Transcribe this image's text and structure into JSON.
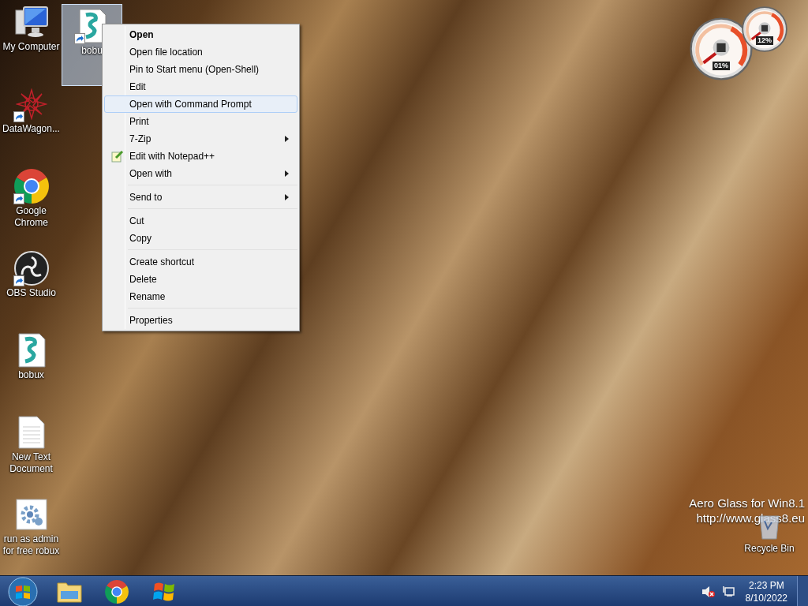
{
  "desktop_icons": [
    {
      "label": "My Computer",
      "kind": "computer",
      "shortcut": false
    },
    {
      "label": "DataWagon...",
      "kind": "mandala",
      "shortcut": true
    },
    {
      "label": "Google Chrome",
      "kind": "chrome",
      "shortcut": true
    },
    {
      "label": "OBS Studio",
      "kind": "obs",
      "shortcut": true
    },
    {
      "label": "bobux",
      "kind": "script",
      "shortcut": false
    },
    {
      "label": "New Text Document",
      "kind": "text",
      "shortcut": false
    },
    {
      "label": "run as admin for free robux",
      "kind": "gear",
      "shortcut": false
    }
  ],
  "selected_icon": {
    "label": "bobu",
    "kind": "script",
    "shortcut": true,
    "selected": true
  },
  "context_menu": [
    {
      "kind": "item",
      "label": "Open",
      "bold": true,
      "selected": false,
      "submenu": false
    },
    {
      "kind": "item",
      "label": "Open file location",
      "bold": false,
      "selected": false,
      "submenu": false
    },
    {
      "kind": "item",
      "label": "Pin to Start menu (Open-Shell)",
      "bold": false,
      "selected": false,
      "submenu": false
    },
    {
      "kind": "item",
      "label": "Edit",
      "bold": false,
      "selected": false,
      "submenu": false
    },
    {
      "kind": "item",
      "label": "Open with Command Prompt",
      "bold": false,
      "selected": true,
      "submenu": false
    },
    {
      "kind": "item",
      "label": "Print",
      "bold": false,
      "selected": false,
      "submenu": false
    },
    {
      "kind": "item",
      "label": "7-Zip",
      "bold": false,
      "selected": false,
      "submenu": true
    },
    {
      "kind": "notepad",
      "label": "Edit with Notepad++",
      "bold": false,
      "selected": false,
      "submenu": false
    },
    {
      "kind": "item",
      "label": "Open with",
      "bold": false,
      "selected": false,
      "submenu": true
    },
    {
      "kind": "separator"
    },
    {
      "kind": "item",
      "label": "Send to",
      "bold": false,
      "selected": false,
      "submenu": true
    },
    {
      "kind": "separator"
    },
    {
      "kind": "item",
      "label": "Cut",
      "bold": false,
      "selected": false,
      "submenu": false
    },
    {
      "kind": "item",
      "label": "Copy",
      "bold": false,
      "selected": false,
      "submenu": false
    },
    {
      "kind": "separator"
    },
    {
      "kind": "item",
      "label": "Create shortcut",
      "bold": false,
      "selected": false,
      "submenu": false
    },
    {
      "kind": "item",
      "label": "Delete",
      "bold": false,
      "selected": false,
      "submenu": false
    },
    {
      "kind": "item",
      "label": "Rename",
      "bold": false,
      "selected": false,
      "submenu": false
    },
    {
      "kind": "separator"
    },
    {
      "kind": "item",
      "label": "Properties",
      "bold": false,
      "selected": false,
      "submenu": false
    }
  ],
  "gadget": {
    "cpu_reading": "01%",
    "memory_reading": "12%"
  },
  "overlay_text": [
    "Aero Glass for Win8.1",
    "http://www.glass8.eu"
  ],
  "recycle_bin": {
    "label": "Recycle Bin"
  },
  "taskbar": {
    "pinned": [
      {
        "kind": "explorer"
      },
      {
        "kind": "chrome"
      },
      {
        "kind": "windows"
      }
    ],
    "time": "2:23 PM",
    "date": "8/10/2022"
  }
}
